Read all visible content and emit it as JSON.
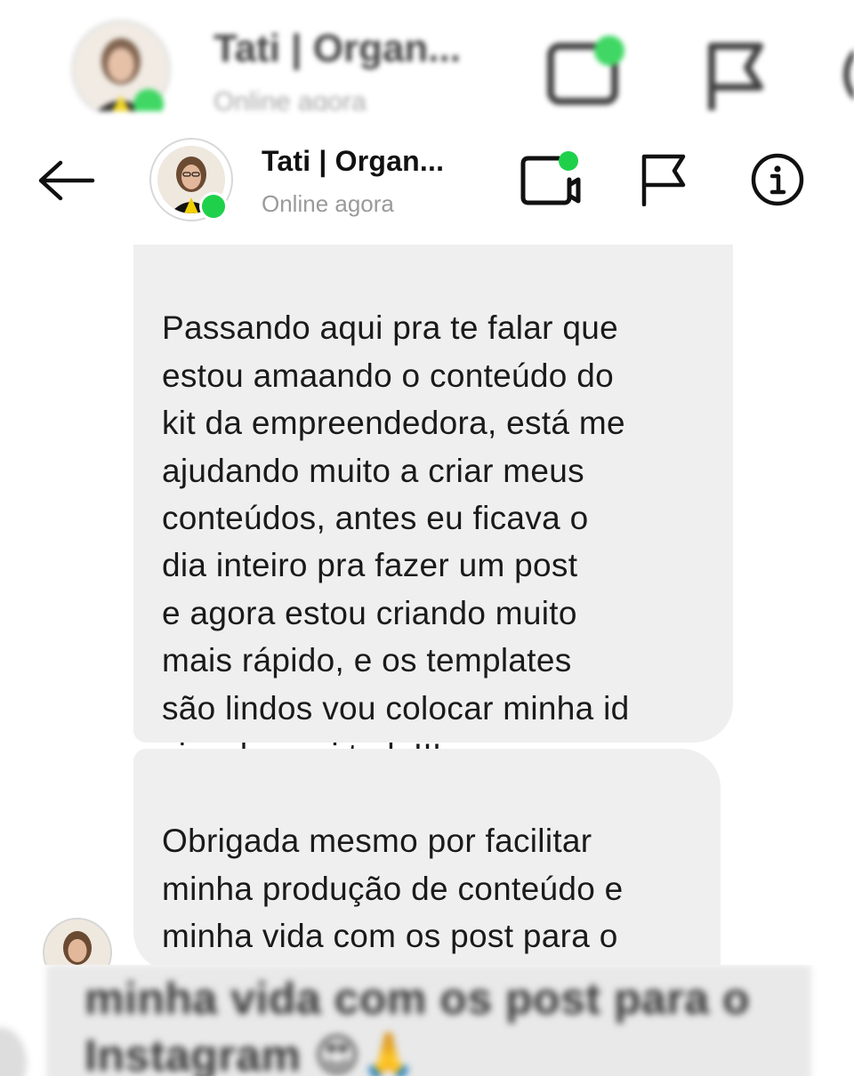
{
  "header": {
    "contact_name": "Tati | Organ...",
    "status": "Online agora",
    "icons": [
      "back-arrow-icon",
      "video-call-icon",
      "flag-icon",
      "info-icon"
    ],
    "online_color": "#1fd14a"
  },
  "messages": [
    {
      "text": "Passando aqui pra te falar que\nestou amaando o conteúdo do\nkit da empreendedora, está me\najudando muito a criar meus\nconteúdos, antes eu ficava o\ndia inteiro pra fazer um post\ne agora estou criando muito\nmais rápido, e os templates\nsão lindos vou colocar minha id\nvisual, amei tudo!!!"
    },
    {
      "text": "Obrigada mesmo por facilitar\nminha produção de conteúdo e\nminha vida com os post para o\nInstagram ",
      "emoji": "😍🙏"
    }
  ],
  "echo": {
    "top_name": "Tati | Organ...",
    "top_status": "Online agora",
    "bottom_text": "minha vida com os post para o\nInstagram 😍🙏"
  },
  "colors": {
    "bubble_bg": "#efefef",
    "status_text": "#9a9a9a"
  }
}
